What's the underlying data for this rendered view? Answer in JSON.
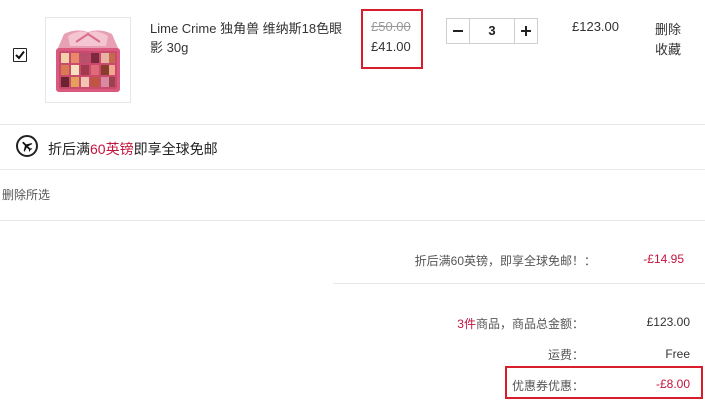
{
  "product": {
    "name": "Lime Crime 独角兽 维纳斯18色眼影 30g",
    "old_price": "£50.00",
    "new_price": "£41.00",
    "quantity": "3",
    "subtotal": "£123.00",
    "delete_label": "删除",
    "favorite_label": "收藏",
    "checked": true
  },
  "promo": {
    "prefix": "折后满",
    "highlight": "60英镑",
    "suffix": "即享全球免邮",
    "icon": "airplane-icon"
  },
  "actions": {
    "delete_selected": "删除所选"
  },
  "summary": {
    "discount_label": "折后满60英镑，即享全球免邮！：",
    "discount_value": "-£14.95",
    "items_count": "3件",
    "items_label": "商品，商品总金额：",
    "items_total": "£123.00",
    "shipping_label": "运费：",
    "shipping_value": "Free",
    "coupon_label": "优惠券优惠：",
    "coupon_value": "-£8.00"
  },
  "colors": {
    "accent_red": "#c3143c",
    "highlight_border": "#d81e2a"
  }
}
